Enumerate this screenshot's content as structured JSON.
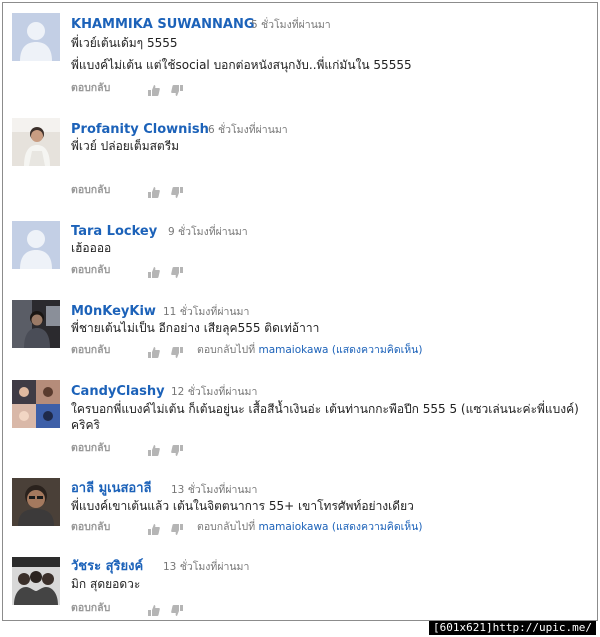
{
  "comments": [
    {
      "username": "KHAMMIKA SUWANNANG",
      "time": "5 ชั่วโมงที่ผ่านมา",
      "lines": [
        "พี่เวย์เต้นเด้มๆ 5555",
        "พี่แบงค์ไม่เต้น แต่ใช้social บอกต่อหนังสนุกงับ..พี่แก่มันใน 55555"
      ],
      "avatar": "default-avatar",
      "reply_label": "ตอบกลับ"
    },
    {
      "username": "Profanity Clownish",
      "time": "6 ชั่วโมงที่ผ่านมา",
      "lines": [
        "พี่เวย์ ปล่อยเต็มสตรีม"
      ],
      "avatar": "photo-avatar",
      "reply_label": "ตอบกลับ"
    },
    {
      "username": "Tara Lockey",
      "time": "9 ชั่วโมงที่ผ่านมา",
      "lines": [
        "เฮ้ออออ"
      ],
      "avatar": "default-avatar",
      "reply_label": "ตอบกลับ"
    },
    {
      "username": "M0nKeyKiw",
      "time": "11 ชั่วโมงที่ผ่านมา",
      "lines": [
        "พี่ชายเต้นไม่เป็น อีกอย่าง เสียลุค555 ติดเท่อ้าาา"
      ],
      "avatar": "photo-avatar",
      "reply_label": "ตอบกลับ",
      "reply_to_prefix": "ตอบกลับไปที่",
      "reply_to_user": "mamaiokawa",
      "reply_to_show": "(แสดงความคิดเห็น)"
    },
    {
      "username": "CandyClashy",
      "time": "12 ชั่วโมงที่ผ่านมา",
      "lines": [
        "ใครบอกพี่แบงค์ไม่เต้น ก็เต้นอยู่นะ เสื้อสีน้ำเงินอ่ะ เต้นท่านกกะพือปีก 555 5 (แซวเล่นนะค่ะพี่แบงค์)",
        "คริคริ"
      ],
      "avatar": "photo-avatar",
      "reply_label": "ตอบกลับ"
    },
    {
      "username": "อาลี มูเนสอาลี",
      "time": "13 ชั่วโมงที่ผ่านมา",
      "lines": [
        "พี่แบงค์เขาเต้นแล้ว เต้นในจิตตนาการ 55+ เขาโทรศัพท์อย่างเดียว"
      ],
      "avatar": "photo-avatar",
      "reply_label": "ตอบกลับ",
      "reply_to_prefix": "ตอบกลับไปที่",
      "reply_to_user": "mamaiokawa",
      "reply_to_show": "(แสดงความคิดเห็น)"
    },
    {
      "username": "วัชระ สุริยงค์",
      "time": "13 ชั่วโมงที่ผ่านมา",
      "lines": [
        "มิก สุดยอดวะ"
      ],
      "avatar": "photo-avatar",
      "reply_label": "ตอบกลับ"
    }
  ],
  "watermark": "[601x621]http://upic.me/",
  "colors": {
    "username": "#1c62b9",
    "text": "#222222",
    "meta": "#777777",
    "reply": "#999999",
    "thumb": "#b5b5b5"
  },
  "icons": {
    "like": "thumbs-up-icon",
    "dislike": "thumbs-down-icon"
  }
}
